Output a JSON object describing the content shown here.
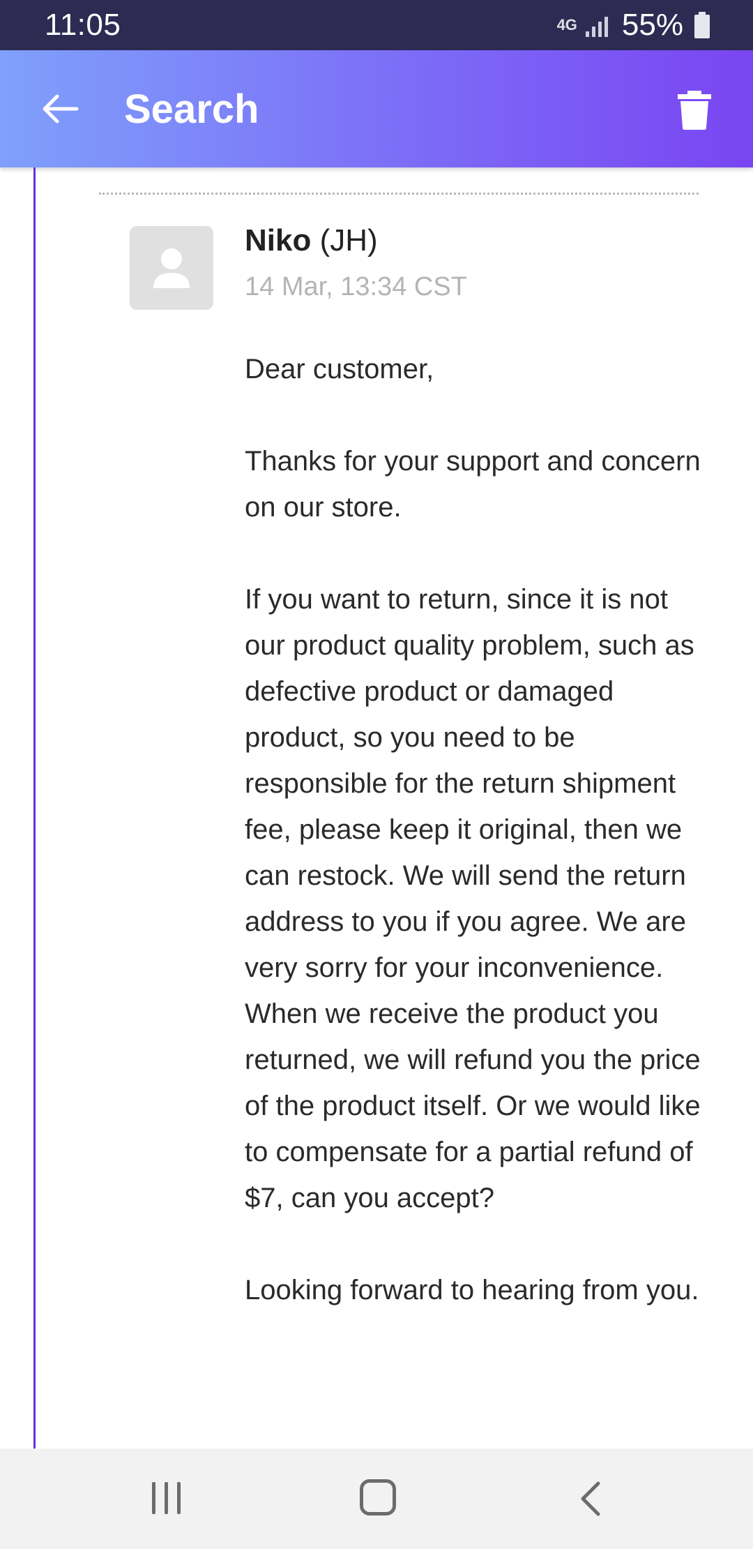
{
  "status_bar": {
    "time": "11:05",
    "network": "4G",
    "battery_percent": "55%",
    "signal_icon": "signal-icon",
    "battery_icon": "battery-icon"
  },
  "app_bar": {
    "title": "Search",
    "back_icon": "arrow-left-icon",
    "delete_icon": "trash-icon",
    "colors": {
      "gradient_start": "#7fa0fb",
      "gradient_end": "#7a45f2"
    }
  },
  "message": {
    "sender_name": "Niko",
    "sender_initials": "(JH)",
    "timestamp": "14 Mar, 13:34 CST",
    "avatar_icon": "person-icon",
    "paragraphs": [
      "Dear customer,",
      "Thanks for your support and concern on our store.",
      "If you want to return, since it is not our product quality problem, such as defective product or damaged product, so you need to be responsible for the return shipment fee, please keep it original, then we can restock. We will send the return address to you if you agree. We are very sorry for your inconvenience. When we receive the product you returned, we will refund you the price of the product itself. Or we would like to compensate for a partial refund of $7, can you accept?",
      "Looking forward to hearing from you."
    ]
  },
  "nav_bar": {
    "recents_icon": "recents-icon",
    "home_icon": "home-icon",
    "back_icon": "chevron-left-icon"
  },
  "thread_color": "#6a2fd8"
}
